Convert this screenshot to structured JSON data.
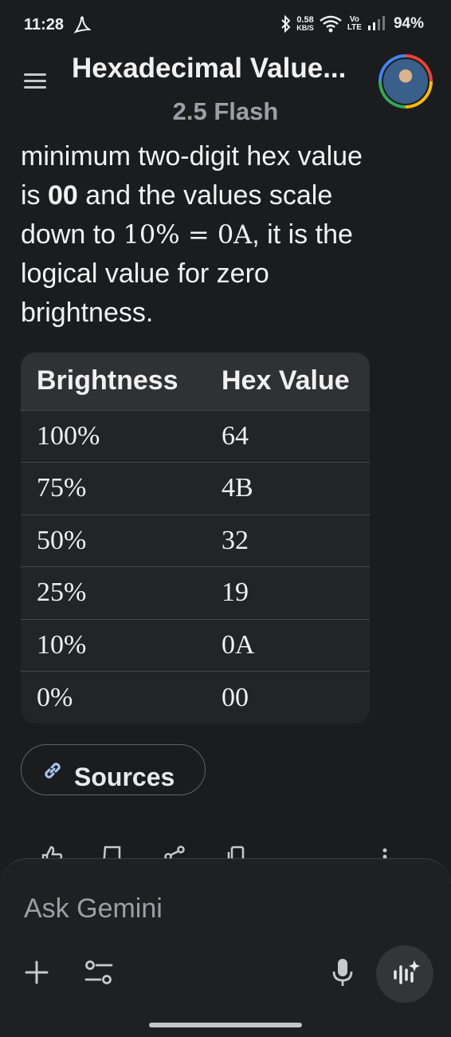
{
  "status_bar": {
    "time": "11:28",
    "speed_value": "0.58",
    "speed_unit": "KB/S",
    "volte_top": "Vo",
    "volte_bottom": "LTE",
    "battery": "94%"
  },
  "header": {
    "title": "Hexadecimal Value...",
    "model": "2.5 Flash"
  },
  "message": {
    "line1": "minimum two-digit hex value",
    "line2_pre": "is ",
    "line2_bold": "00",
    "line2_post": " and the values scale",
    "line3_pre": "down to ",
    "math": "10% = 0A",
    "line3_post": ", it is the",
    "line4": "logical value for zero",
    "line5": "brightness."
  },
  "table": {
    "headers": [
      "Brightness",
      "Hex Value"
    ],
    "rows": [
      [
        "100%",
        "64"
      ],
      [
        "75%",
        "4B"
      ],
      [
        "50%",
        "32"
      ],
      [
        "25%",
        "19"
      ],
      [
        "10%",
        "0A"
      ],
      [
        "0%",
        "00"
      ]
    ]
  },
  "sources": {
    "label": "Sources"
  },
  "input": {
    "placeholder": "Ask Gemini"
  },
  "icons": {
    "menu": "menu-icon",
    "link": "link-icon",
    "thumbs_up": "thumbs-up-icon",
    "thumbs_down": "thumbs-down-icon",
    "share": "share-icon",
    "copy": "copy-icon",
    "more": "more-vert-icon",
    "plus": "plus-icon",
    "tools": "tools-icon",
    "mic": "mic-icon",
    "live": "live-waveform-icon"
  },
  "colors": {
    "background": "#1b1c1e",
    "table_header": "#303134",
    "table_body": "#232426",
    "link_icon": "#a8c7fa",
    "muted_text": "#9aa0a6"
  }
}
